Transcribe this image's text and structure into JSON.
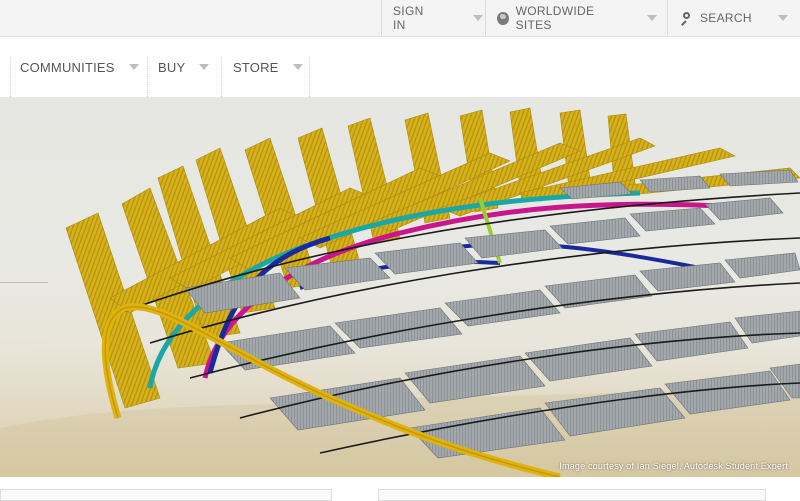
{
  "utility_bar": {
    "sign_in": "SIGN IN",
    "worldwide_sites": "WORLDWIDE SITES",
    "search": "SEARCH"
  },
  "main_nav": {
    "items": [
      {
        "label": "COMMUNITIES"
      },
      {
        "label": "BUY"
      },
      {
        "label": "STORE"
      }
    ]
  },
  "hero": {
    "image_credit": "Image courtesy of Ian Siegel, Autodesk Student Expert"
  },
  "icons": {
    "globe": "globe-icon",
    "search": "search-icon",
    "dropdown": "chevron-down-icon"
  },
  "colors": {
    "topbar_bg": "#f4f4f4",
    "fin_yellow": "#d9b51c",
    "panel_gray": "#9fa4a7",
    "pipe_yellow": "#e0b30c",
    "magenta": "#c8168c",
    "navy": "#1a2a9c",
    "teal": "#1aa7a7"
  }
}
